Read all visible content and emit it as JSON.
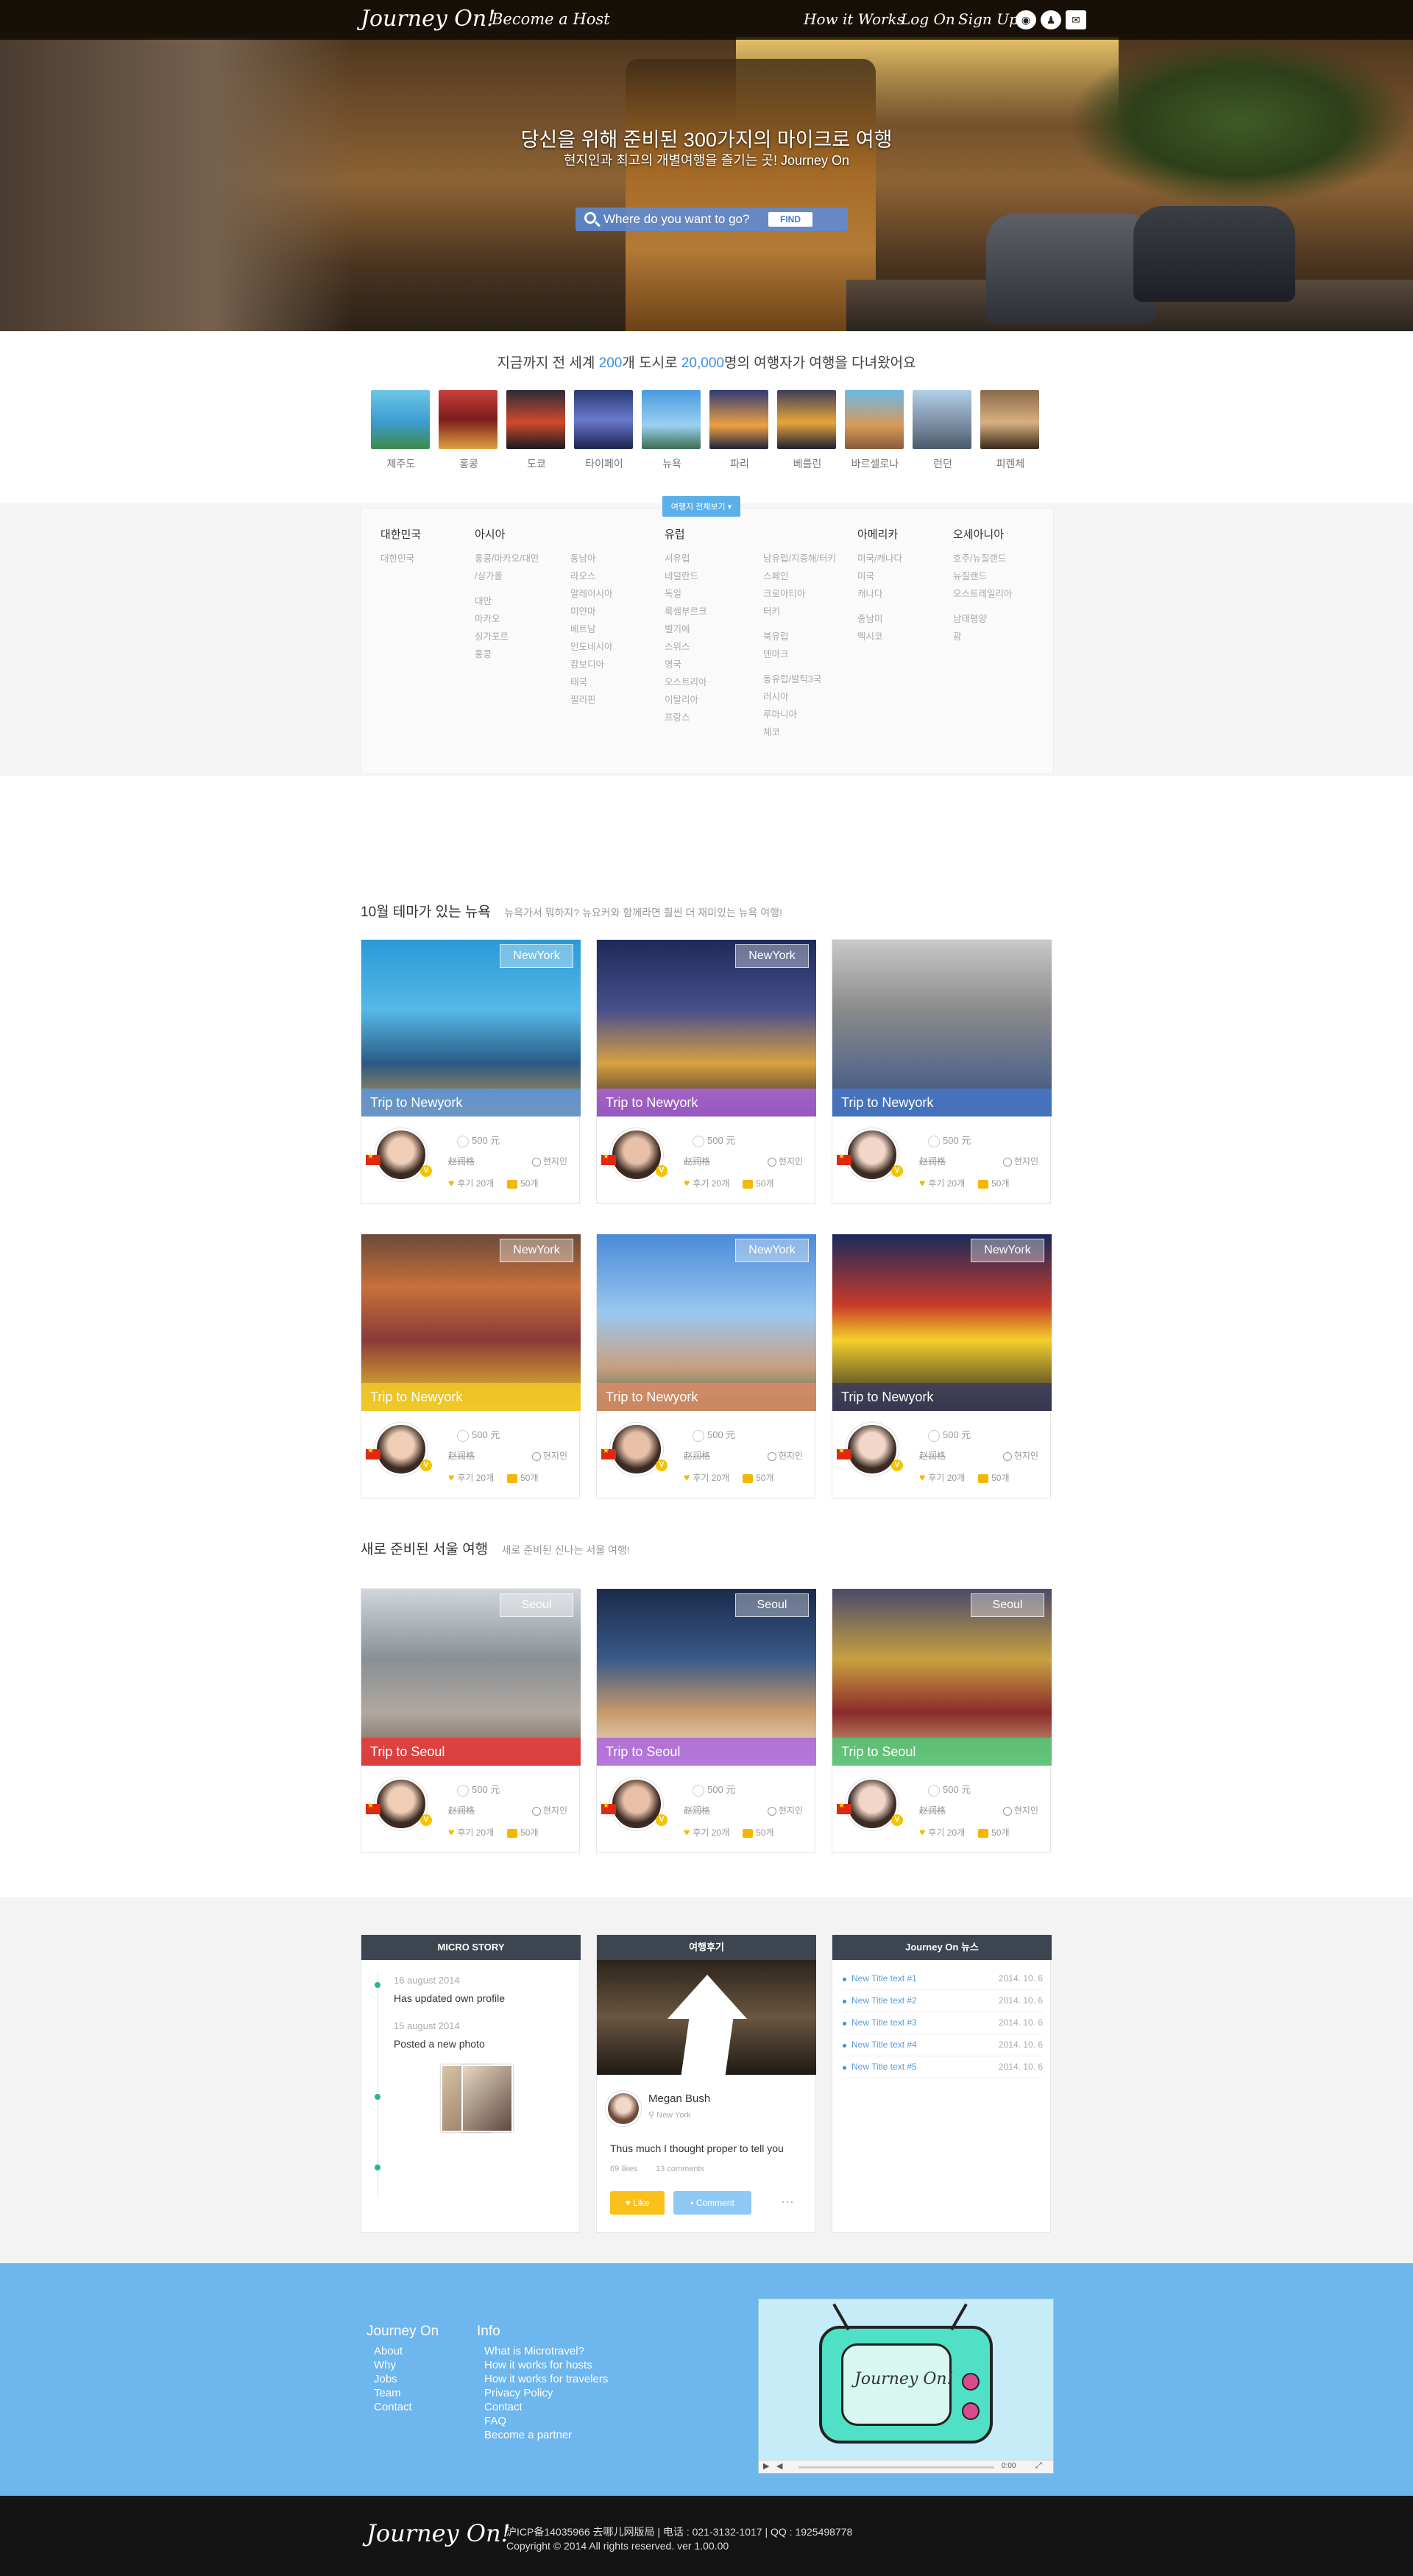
{
  "nav": {
    "logo": "Journey On!",
    "become": "Become a Host",
    "links": [
      "How it Works",
      "Log On",
      "Sign Up"
    ],
    "icons": [
      "weibo-icon",
      "qq-icon",
      "wechat-icon"
    ]
  },
  "hero": {
    "title": "당신을 위해 준비된 300가지의 마이크로 여행",
    "subtitle": "현지인과 최고의 개별여행을 즐기는 곳! Journey On",
    "search_placeholder": "Where do you want to go?",
    "find": "FIND"
  },
  "stats": {
    "prefix": "지금까지 전 세계 ",
    "cities": "200",
    "mid": "개 도시로 ",
    "travelers": "20,000",
    "suffix": "명의 여행자가 여행을 다녀왔어요"
  },
  "cities": [
    "제주도",
    "홍콩",
    "도쿄",
    "타이페이",
    "뉴욕",
    "파리",
    "베를린",
    "바르셀로나",
    "런던",
    "피렌체"
  ],
  "region": {
    "toggle": "여행지 전체보기",
    "columns": [
      {
        "head": "대한민국",
        "groups": [
          {
            "items": [
              "대한민국"
            ]
          }
        ]
      },
      {
        "head": "아시아",
        "groups": [
          {
            "items": [
              "홍콩/마카오/대만",
              "/싱가폴",
              "",
              "대만",
              "마카오",
              "싱가포르",
              "홍콩"
            ]
          }
        ]
      },
      {
        "head": "",
        "groups": [
          {
            "items": [
              "동남아",
              "라오스",
              "말레이시아",
              "미얀마",
              "베트남",
              "인도네시아",
              "캄보디아",
              "태국",
              "필리핀"
            ]
          }
        ]
      },
      {
        "head": "유럽",
        "groups": [
          {
            "items": [
              "서유럽",
              "네덜란드",
              "독일",
              "룩셈부르크",
              "벨기에",
              "스위스",
              "영국",
              "오스트리아",
              "이탈리아",
              "프랑스"
            ]
          }
        ]
      },
      {
        "head": "",
        "groups": [
          {
            "items": [
              "남유럽/지중해/터키",
              "스페인",
              "크로아티아",
              "터키",
              "",
              "북유럽",
              "덴마크",
              "",
              "동유럽/발틱3국",
              "러시아",
              "루마니아",
              "체코"
            ]
          }
        ]
      },
      {
        "head": "아메리카",
        "groups": [
          {
            "items": [
              "미국/캐나다",
              "미국",
              "캐나다",
              "",
              "중남미",
              "멕시코"
            ]
          }
        ]
      },
      {
        "head": "오세아니아",
        "groups": [
          {
            "items": [
              "호주/뉴질랜드",
              "뉴질랜드",
              "오스트레일리아",
              "",
              "남태평양",
              "괌"
            ]
          }
        ]
      }
    ]
  },
  "sections": [
    {
      "title": "10월 테마가 있는 뉴욕",
      "subtitle": "뉴욕가서 뭐하지? 뉴요커와 함께라면 훨씬 더 재미있는 뉴욕 여행!",
      "cards": [
        {
          "tag": "NewYork",
          "band": "Trip to Newyork",
          "price": "500 元",
          "author": "赵润格",
          "loc": "현지인",
          "likes": "후기 20개",
          "comments": "50개"
        },
        {
          "tag": "NewYork",
          "band": "Trip to Newyork",
          "price": "500 元",
          "author": "赵润格",
          "loc": "현지인",
          "likes": "후기 20개",
          "comments": "50개"
        },
        {
          "tag": "",
          "band": "Trip to Newyork",
          "price": "500 元",
          "author": "赵润格",
          "loc": "현지인",
          "likes": "후기 20개",
          "comments": "50개"
        },
        {
          "tag": "NewYork",
          "band": "Trip to Newyork",
          "price": "500 元",
          "author": "赵润格",
          "loc": "현지인",
          "likes": "후기 20개",
          "comments": "50개"
        },
        {
          "tag": "NewYork",
          "band": "Trip to Newyork",
          "price": "500 元",
          "author": "赵润格",
          "loc": "현지인",
          "likes": "후기 20개",
          "comments": "50개"
        },
        {
          "tag": "NewYork",
          "band": "Trip to Newyork",
          "price": "500 元",
          "author": "赵润格",
          "loc": "현지인",
          "likes": "후기 20개",
          "comments": "50개"
        }
      ]
    },
    {
      "title": "새로 준비된 서울 여행",
      "subtitle": "새로 준비된 신나는 서울 여행!",
      "cards": [
        {
          "tag": "Seoul",
          "band": "Trip to Seoul",
          "price": "500 元",
          "author": "赵润格",
          "loc": "현지인",
          "likes": "후기 20개",
          "comments": "50개"
        },
        {
          "tag": "Seoul",
          "band": "Trip to Seoul",
          "price": "500 元",
          "author": "赵润格",
          "loc": "현지인",
          "likes": "후기 20개",
          "comments": "50개"
        },
        {
          "tag": "Seoul",
          "band": "Trip to Seoul",
          "price": "500 元",
          "author": "赵润格",
          "loc": "현지인",
          "likes": "후기 20개",
          "comments": "50개"
        }
      ]
    }
  ],
  "micro": {
    "head": "MICRO STORY",
    "entries": [
      {
        "date": "16 august 2014",
        "text": "Has updated own profile"
      },
      {
        "date": "15 august 2014",
        "text": "Posted a new photo"
      }
    ]
  },
  "review": {
    "head": "여행후기",
    "name": "Megan Bush",
    "location": "New York",
    "text": "Thus much I thought proper to tell you",
    "likes": "69 likes",
    "comments": "13 comments",
    "like_btn": "Like",
    "comment_btn": "Comment",
    "more": "···"
  },
  "news": {
    "head": "Journey On 뉴스",
    "items": [
      {
        "t": "New Title text #1",
        "d": "2014. 10. 6"
      },
      {
        "t": "New Title text #2",
        "d": "2014. 10. 6"
      },
      {
        "t": "New Title text #3",
        "d": "2014. 10. 6"
      },
      {
        "t": "New Title text #4",
        "d": "2014. 10. 6"
      },
      {
        "t": "New Title text #5",
        "d": "2014. 10. 6"
      }
    ]
  },
  "footer": {
    "col1_head": "Journey On",
    "col1": [
      "About",
      "Why",
      "Jobs",
      "Team",
      "Contact"
    ],
    "col2_head": "Info",
    "col2": [
      "What is Microtravel?",
      "How it works for hosts",
      "How it works for travelers",
      "Privacy Policy",
      "Contact",
      "FAQ",
      "Become a partner"
    ],
    "video_logo": "Journey On!",
    "video_time": "0:00",
    "logo": "Journey On!",
    "copy1": "沪ICP备14035966 去哪儿网版局 | 电话 : 021-3132-1017 | QQ : 1925498778",
    "copy2": "Copyright © 2014 All rights reserved. ver 1.00.00"
  }
}
